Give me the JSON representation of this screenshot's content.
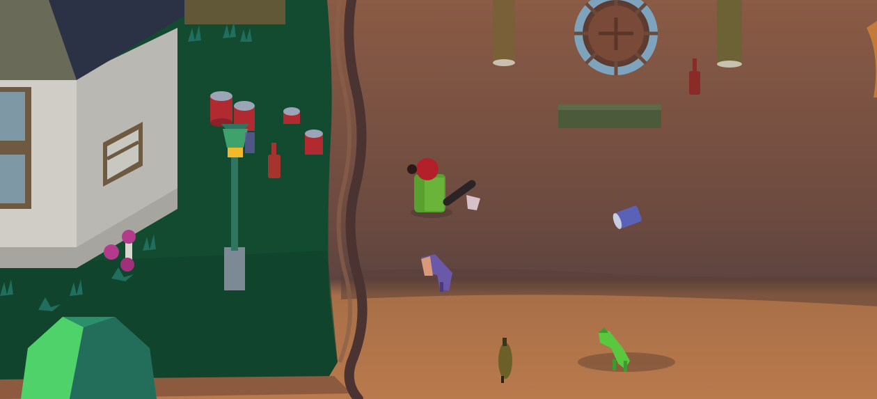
{
  "game": {
    "kind": "isometric low-poly neighborhood scene",
    "hud_text": []
  },
  "palette": {
    "ground_dirt": "#6f4b3e",
    "ground_sunlit": "#b7764a",
    "grass": "#124d32",
    "house_wall": "#d8d6cf",
    "roof": "#2d3347",
    "player_shirt": "#5aa02e",
    "player_hat": "#b3202a"
  },
  "objects": {
    "house": "house",
    "lamp_post": "street-lamp",
    "player": "player-character",
    "bat": "baseball-bat",
    "fire_pit": "fire-pit",
    "bench": "wooden-bench",
    "bottles": [
      "bottle",
      "bottle"
    ],
    "cans": [
      "soda-can"
    ],
    "trash_barrels": [
      "red-barrel",
      "red-barrel",
      "red-barrel",
      "red-barrel"
    ],
    "animals": [
      "purple-cat",
      "green-dog",
      "small-bird"
    ],
    "plants": [
      "pink-flowers",
      "green-bush"
    ]
  }
}
